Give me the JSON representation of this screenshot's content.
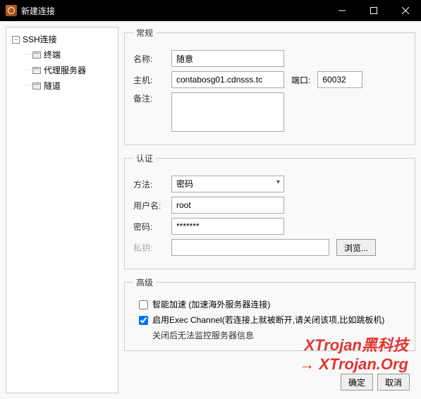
{
  "window": {
    "title": "新建连接",
    "buttons": {
      "min": "minimize",
      "max": "maximize",
      "close": "close"
    }
  },
  "sidebar": {
    "root": "SSH连接",
    "items": [
      {
        "label": "终端"
      },
      {
        "label": "代理服务器"
      },
      {
        "label": "隧道"
      }
    ]
  },
  "general": {
    "legend": "常规",
    "name_label": "名称:",
    "name_value": "随意",
    "host_label": "主机:",
    "host_value": "contabosg01.cdnsss.tc",
    "port_label": "端口:",
    "port_value": "60032",
    "remark_label": "备注:",
    "remark_value": ""
  },
  "auth": {
    "legend": "认证",
    "method_label": "方法:",
    "method_value": "密码",
    "user_label": "用户名:",
    "user_value": "root",
    "pass_label": "密码:",
    "pass_value": "*******",
    "key_label": "私钥:",
    "browse": "浏览..."
  },
  "advanced": {
    "legend": "高级",
    "opt1": "智能加速 (加速海外服务器连接)",
    "opt1_checked": false,
    "opt2": "启用Exec Channel(若连接上就被断开,请关闭该项,比如跳板机)",
    "opt2_checked": true,
    "note": "关闭后无法监控服务器信息"
  },
  "footer": {
    "ok": "确定",
    "cancel": "取消"
  },
  "watermark": {
    "line1": "XTrojan黑科技",
    "line2": "→ XTrojan.Org"
  }
}
